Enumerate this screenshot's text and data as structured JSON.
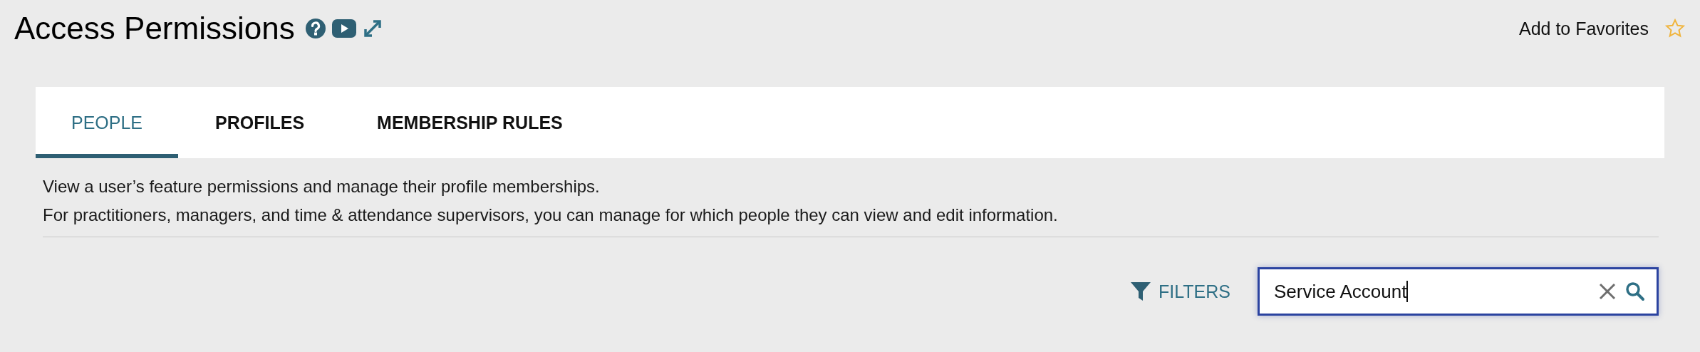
{
  "page": {
    "title": "Access Permissions",
    "favorites_link": "Add to Favorites",
    "favorited": false
  },
  "tabs": [
    {
      "label": "PEOPLE",
      "selected": true
    },
    {
      "label": "PROFILES",
      "selected": false
    },
    {
      "label": "MEMBERSHIP RULES",
      "selected": false
    }
  ],
  "description": [
    "View a user’s feature permissions and manage their profile memberships.",
    "For practitioners, managers, and time & attendance supervisors, you can manage for which people they can view and edit information."
  ],
  "filters": {
    "label": "FILTERS"
  },
  "search": {
    "value": "Service Account",
    "focused": true
  }
}
